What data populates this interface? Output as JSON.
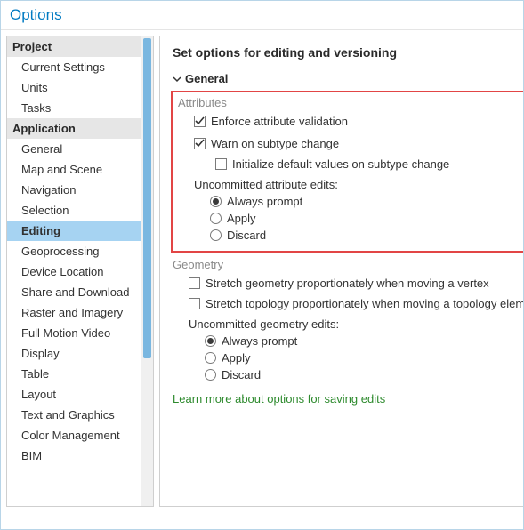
{
  "window": {
    "title": "Options"
  },
  "sidebar": {
    "groups": [
      {
        "header": "Project",
        "items": [
          "Current Settings",
          "Units",
          "Tasks"
        ]
      },
      {
        "header": "Application",
        "items": [
          "General",
          "Map and Scene",
          "Navigation",
          "Selection",
          "Editing",
          "Geoprocessing",
          "Device Location",
          "Share and Download",
          "Raster and Imagery",
          "Full Motion Video",
          "Display",
          "Table",
          "Layout",
          "Text and Graphics",
          "Color Management",
          "BIM"
        ]
      }
    ],
    "selected": "Editing"
  },
  "main": {
    "title": "Set options for editing and versioning",
    "section_general": "General",
    "attributes": {
      "label": "Attributes",
      "enforce": {
        "label": "Enforce attribute validation",
        "checked": true
      },
      "warn_subtype": {
        "label": "Warn on subtype change",
        "checked": true
      },
      "init_defaults": {
        "label": "Initialize default values on subtype change",
        "checked": false
      },
      "uncommitted_label": "Uncommitted attribute edits:",
      "radios": {
        "always": "Always prompt",
        "apply": "Apply",
        "discard": "Discard",
        "selected": "always"
      }
    },
    "geometry": {
      "label": "Geometry",
      "stretch_vertex": {
        "label": "Stretch geometry proportionately when moving a vertex",
        "checked": false
      },
      "stretch_topology": {
        "label": "Stretch topology proportionately when moving a topology eleme",
        "checked": false
      },
      "uncommitted_label": "Uncommitted geometry edits:",
      "radios": {
        "always": "Always prompt",
        "apply": "Apply",
        "discard": "Discard",
        "selected": "always"
      }
    },
    "learn_more": "Learn more about options for saving edits"
  }
}
